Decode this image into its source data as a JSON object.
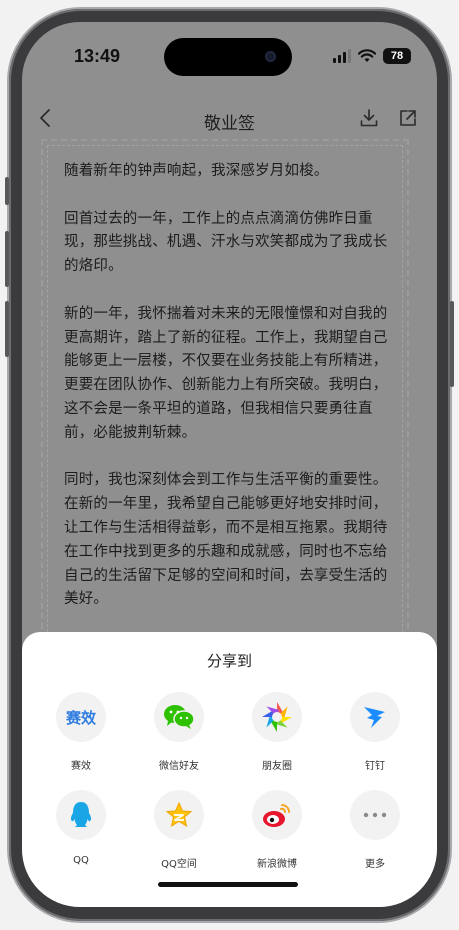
{
  "status": {
    "time": "13:49",
    "battery": "78"
  },
  "nav": {
    "title": "敬业签"
  },
  "letter": {
    "paragraphs": [
      "随着新年的钟声响起，我深感岁月如梭。",
      "回首过去的一年，工作上的点点滴滴仿佛昨日重现，那些挑战、机遇、汗水与欢笑都成为了我成长的烙印。",
      "新的一年，我怀揣着对未来的无限憧憬和对自我的更高期许，踏上了新的征程。工作上，我期望自己能够更上一层楼，不仅要在业务技能上有所精进，更要在团队协作、创新能力上有所突破。我明白，这不会是一条平坦的道路，但我相信只要勇往直前，必能披荆斩棘。",
      "同时，我也深刻体会到工作与生活平衡的重要性。在新的一年里，我希望自己能够更好地安排时间，让工作与生活相得益彰，而不是相互拖累。我期待在工作中找到更多的乐趣和成就感，同时也不忘给自己的生活留下足够的空间和时间，去享受生活的美好。"
    ]
  },
  "share": {
    "title": "分享到",
    "saixiao_glyph": "赛效",
    "items": [
      {
        "label": "赛效",
        "icon": "saixiao-icon"
      },
      {
        "label": "微信好友",
        "icon": "wechat-icon"
      },
      {
        "label": "朋友圈",
        "icon": "moments-icon"
      },
      {
        "label": "钉钉",
        "icon": "dingtalk-icon"
      },
      {
        "label": "QQ",
        "icon": "qq-icon"
      },
      {
        "label": "QQ空间",
        "icon": "qzone-icon"
      },
      {
        "label": "新浪微博",
        "icon": "weibo-icon"
      },
      {
        "label": "更多",
        "icon": "more-icon"
      }
    ]
  },
  "colors": {
    "dim_background": "#8f8f8f",
    "sheet": "#ffffff",
    "wechat_green": "#2dc100",
    "dingtalk_blue": "#1a8cff",
    "saixiao_blue": "#2f7de1"
  }
}
